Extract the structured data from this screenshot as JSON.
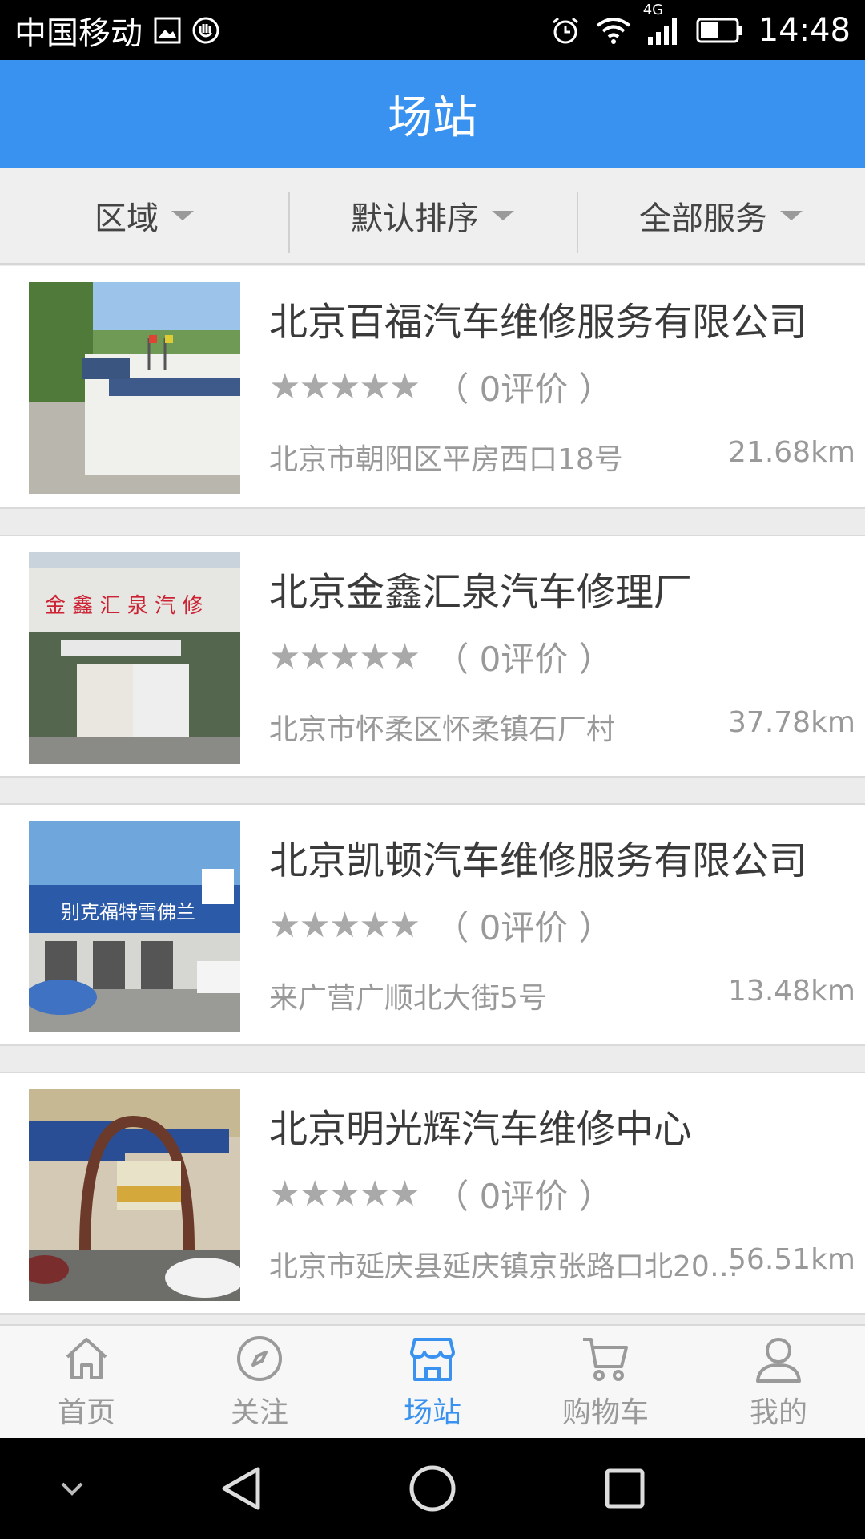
{
  "status_bar": {
    "carrier": "中国移动",
    "network": "4G",
    "time": "14:48"
  },
  "header": {
    "title": "场站"
  },
  "filters": [
    {
      "label": "区域"
    },
    {
      "label": "默认排序"
    },
    {
      "label": "全部服务"
    }
  ],
  "stations": [
    {
      "name": "北京百福汽车维修服务有限公司",
      "stars": "★★★★★",
      "reviews": "（ 0评价 ）",
      "address": "北京市朝阳区平房西口18号",
      "distance": "21.68km"
    },
    {
      "name": "北京金鑫汇泉汽车修理厂",
      "stars": "★★★★★",
      "reviews": "（ 0评价 ）",
      "address": "北京市怀柔区怀柔镇石厂村",
      "distance": "37.78km"
    },
    {
      "name": "北京凯顿汽车维修服务有限公司",
      "stars": "★★★★★",
      "reviews": "（ 0评价 ）",
      "address": "来广营广顺北大街5号",
      "distance": "13.48km"
    },
    {
      "name": "北京明光辉汽车维修中心",
      "stars": "★★★★★",
      "reviews": "（ 0评价 ）",
      "address": "北京市延庆县延庆镇京张路口北200...",
      "distance": "56.51km"
    }
  ],
  "tabs": [
    {
      "label": "首页",
      "icon": "home-icon"
    },
    {
      "label": "关注",
      "icon": "compass-icon"
    },
    {
      "label": "场站",
      "icon": "store-icon",
      "active": true
    },
    {
      "label": "购物车",
      "icon": "cart-icon"
    },
    {
      "label": "我的",
      "icon": "user-icon"
    }
  ],
  "colors": {
    "accent": "#3a92f0",
    "header_bg": "#3a92f0"
  }
}
